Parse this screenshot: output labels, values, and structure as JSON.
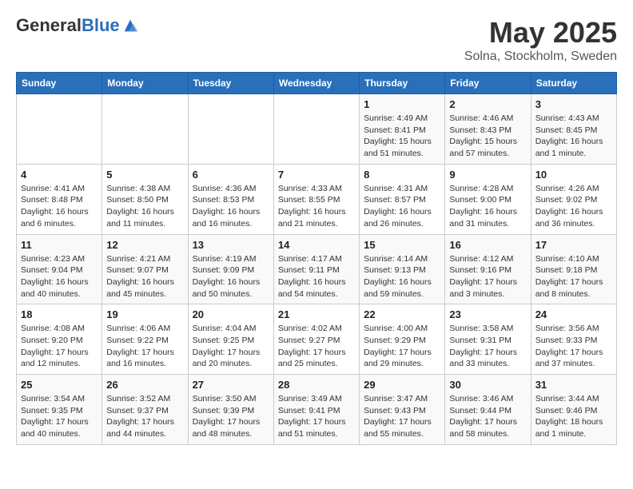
{
  "header": {
    "logo_general": "General",
    "logo_blue": "Blue",
    "title": "May 2025",
    "subtitle": "Solna, Stockholm, Sweden"
  },
  "weekdays": [
    "Sunday",
    "Monday",
    "Tuesday",
    "Wednesday",
    "Thursday",
    "Friday",
    "Saturday"
  ],
  "weeks": [
    [
      {
        "date": "",
        "info": ""
      },
      {
        "date": "",
        "info": ""
      },
      {
        "date": "",
        "info": ""
      },
      {
        "date": "",
        "info": ""
      },
      {
        "date": "1",
        "info": "Sunrise: 4:49 AM\nSunset: 8:41 PM\nDaylight: 15 hours and 51 minutes."
      },
      {
        "date": "2",
        "info": "Sunrise: 4:46 AM\nSunset: 8:43 PM\nDaylight: 15 hours and 57 minutes."
      },
      {
        "date": "3",
        "info": "Sunrise: 4:43 AM\nSunset: 8:45 PM\nDaylight: 16 hours and 1 minute."
      }
    ],
    [
      {
        "date": "4",
        "info": "Sunrise: 4:41 AM\nSunset: 8:48 PM\nDaylight: 16 hours and 6 minutes."
      },
      {
        "date": "5",
        "info": "Sunrise: 4:38 AM\nSunset: 8:50 PM\nDaylight: 16 hours and 11 minutes."
      },
      {
        "date": "6",
        "info": "Sunrise: 4:36 AM\nSunset: 8:53 PM\nDaylight: 16 hours and 16 minutes."
      },
      {
        "date": "7",
        "info": "Sunrise: 4:33 AM\nSunset: 8:55 PM\nDaylight: 16 hours and 21 minutes."
      },
      {
        "date": "8",
        "info": "Sunrise: 4:31 AM\nSunset: 8:57 PM\nDaylight: 16 hours and 26 minutes."
      },
      {
        "date": "9",
        "info": "Sunrise: 4:28 AM\nSunset: 9:00 PM\nDaylight: 16 hours and 31 minutes."
      },
      {
        "date": "10",
        "info": "Sunrise: 4:26 AM\nSunset: 9:02 PM\nDaylight: 16 hours and 36 minutes."
      }
    ],
    [
      {
        "date": "11",
        "info": "Sunrise: 4:23 AM\nSunset: 9:04 PM\nDaylight: 16 hours and 40 minutes."
      },
      {
        "date": "12",
        "info": "Sunrise: 4:21 AM\nSunset: 9:07 PM\nDaylight: 16 hours and 45 minutes."
      },
      {
        "date": "13",
        "info": "Sunrise: 4:19 AM\nSunset: 9:09 PM\nDaylight: 16 hours and 50 minutes."
      },
      {
        "date": "14",
        "info": "Sunrise: 4:17 AM\nSunset: 9:11 PM\nDaylight: 16 hours and 54 minutes."
      },
      {
        "date": "15",
        "info": "Sunrise: 4:14 AM\nSunset: 9:13 PM\nDaylight: 16 hours and 59 minutes."
      },
      {
        "date": "16",
        "info": "Sunrise: 4:12 AM\nSunset: 9:16 PM\nDaylight: 17 hours and 3 minutes."
      },
      {
        "date": "17",
        "info": "Sunrise: 4:10 AM\nSunset: 9:18 PM\nDaylight: 17 hours and 8 minutes."
      }
    ],
    [
      {
        "date": "18",
        "info": "Sunrise: 4:08 AM\nSunset: 9:20 PM\nDaylight: 17 hours and 12 minutes."
      },
      {
        "date": "19",
        "info": "Sunrise: 4:06 AM\nSunset: 9:22 PM\nDaylight: 17 hours and 16 minutes."
      },
      {
        "date": "20",
        "info": "Sunrise: 4:04 AM\nSunset: 9:25 PM\nDaylight: 17 hours and 20 minutes."
      },
      {
        "date": "21",
        "info": "Sunrise: 4:02 AM\nSunset: 9:27 PM\nDaylight: 17 hours and 25 minutes."
      },
      {
        "date": "22",
        "info": "Sunrise: 4:00 AM\nSunset: 9:29 PM\nDaylight: 17 hours and 29 minutes."
      },
      {
        "date": "23",
        "info": "Sunrise: 3:58 AM\nSunset: 9:31 PM\nDaylight: 17 hours and 33 minutes."
      },
      {
        "date": "24",
        "info": "Sunrise: 3:56 AM\nSunset: 9:33 PM\nDaylight: 17 hours and 37 minutes."
      }
    ],
    [
      {
        "date": "25",
        "info": "Sunrise: 3:54 AM\nSunset: 9:35 PM\nDaylight: 17 hours and 40 minutes."
      },
      {
        "date": "26",
        "info": "Sunrise: 3:52 AM\nSunset: 9:37 PM\nDaylight: 17 hours and 44 minutes."
      },
      {
        "date": "27",
        "info": "Sunrise: 3:50 AM\nSunset: 9:39 PM\nDaylight: 17 hours and 48 minutes."
      },
      {
        "date": "28",
        "info": "Sunrise: 3:49 AM\nSunset: 9:41 PM\nDaylight: 17 hours and 51 minutes."
      },
      {
        "date": "29",
        "info": "Sunrise: 3:47 AM\nSunset: 9:43 PM\nDaylight: 17 hours and 55 minutes."
      },
      {
        "date": "30",
        "info": "Sunrise: 3:46 AM\nSunset: 9:44 PM\nDaylight: 17 hours and 58 minutes."
      },
      {
        "date": "31",
        "info": "Sunrise: 3:44 AM\nSunset: 9:46 PM\nDaylight: 18 hours and 1 minute."
      }
    ]
  ]
}
